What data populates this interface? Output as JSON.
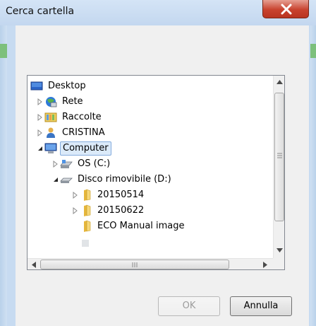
{
  "window": {
    "title": "Cerca cartella",
    "close_glyph": "X"
  },
  "tree": {
    "items": [
      {
        "label": "Desktop",
        "icon": "desktop-icon",
        "expander": "none",
        "level": 0
      },
      {
        "label": "Rete",
        "icon": "network-icon",
        "expander": "collapsed",
        "level": 1
      },
      {
        "label": "Raccolte",
        "icon": "libraries-icon",
        "expander": "collapsed",
        "level": 1
      },
      {
        "label": "CRISTINA",
        "icon": "user-icon",
        "expander": "collapsed",
        "level": 1
      },
      {
        "label": "Computer",
        "icon": "computer-icon",
        "expander": "expanded",
        "level": 1,
        "selected": true
      },
      {
        "label": "OS (C:)",
        "icon": "drive-icon",
        "expander": "collapsed",
        "level": 2
      },
      {
        "label": "Disco rimovibile (D:)",
        "icon": "removable-drive-icon",
        "expander": "expanded",
        "level": 2
      },
      {
        "label": "20150514",
        "icon": "folder-icon",
        "expander": "collapsed",
        "level": 3
      },
      {
        "label": "20150622",
        "icon": "folder-icon",
        "expander": "collapsed",
        "level": 3
      },
      {
        "label": "ECO Manual image",
        "icon": "folder-icon",
        "expander": "none",
        "level": 3
      }
    ]
  },
  "buttons": {
    "ok_label": "OK",
    "cancel_label": "Annulla"
  },
  "colors": {
    "selection_bg": "#dbeaf9",
    "selection_border": "#84acdd",
    "close_button": "#c8422e"
  }
}
